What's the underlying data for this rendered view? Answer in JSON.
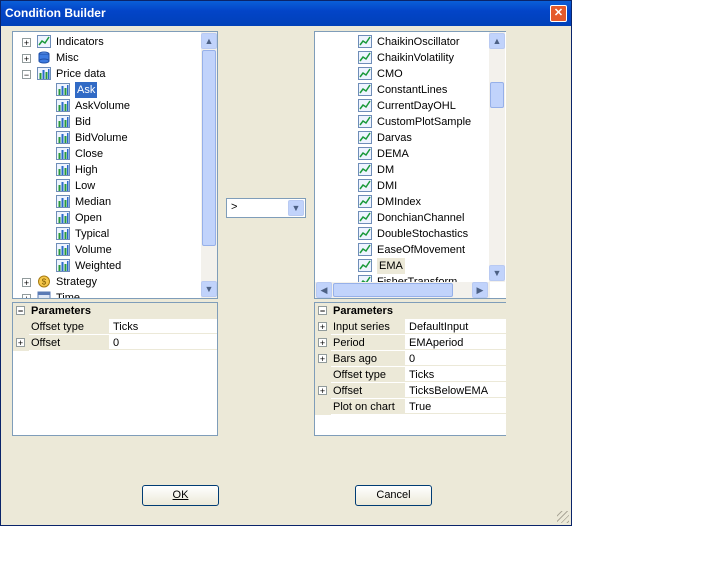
{
  "window": {
    "title": "Condition Builder",
    "close_glyph": "✕"
  },
  "left_tree": {
    "items": [
      {
        "label": "Indicators",
        "expander": "+",
        "icon": "indicator-icon"
      },
      {
        "label": "Misc",
        "expander": "+",
        "icon": "cylinder-icon"
      },
      {
        "label": "Price data",
        "expander": "−",
        "icon": "bar-chart-icon"
      },
      {
        "label": "Ask",
        "icon": "bar-chart-icon",
        "selected": true
      },
      {
        "label": "AskVolume",
        "icon": "bar-chart-icon"
      },
      {
        "label": "Bid",
        "icon": "bar-chart-icon"
      },
      {
        "label": "BidVolume",
        "icon": "bar-chart-icon"
      },
      {
        "label": "Close",
        "icon": "bar-chart-icon"
      },
      {
        "label": "High",
        "icon": "bar-chart-icon"
      },
      {
        "label": "Low",
        "icon": "bar-chart-icon"
      },
      {
        "label": "Median",
        "icon": "bar-chart-icon"
      },
      {
        "label": "Open",
        "icon": "bar-chart-icon"
      },
      {
        "label": "Typical",
        "icon": "bar-chart-icon"
      },
      {
        "label": "Volume",
        "icon": "bar-chart-icon"
      },
      {
        "label": "Weighted",
        "icon": "bar-chart-icon"
      },
      {
        "label": "Strategy",
        "expander": "+",
        "icon": "coin-icon"
      },
      {
        "label": "Time",
        "expander": "+",
        "icon": "calendar-icon"
      }
    ]
  },
  "left_params": {
    "header": "Parameters",
    "rows": [
      {
        "name": "Offset type",
        "value": "Ticks",
        "expandable": false
      },
      {
        "name": "Offset",
        "value": "0",
        "expandable": true
      }
    ]
  },
  "operator": {
    "value": ">"
  },
  "right_tree": {
    "items": [
      "ChaikinOscillator",
      "ChaikinVolatility",
      "CMO",
      "ConstantLines",
      "CurrentDayOHL",
      "CustomPlotSample",
      "Darvas",
      "DEMA",
      "DM",
      "DMI",
      "DMIndex",
      "DonchianChannel",
      "DoubleStochastics",
      "EaseOfMovement",
      "EMA",
      "FisherTransform"
    ],
    "selected": "EMA"
  },
  "right_params": {
    "header": "Parameters",
    "rows": [
      {
        "name": "Input series",
        "value": "DefaultInput",
        "expandable": true
      },
      {
        "name": "Period",
        "value": "EMAperiod",
        "expandable": true
      },
      {
        "name": "Bars ago",
        "value": "0",
        "expandable": true
      },
      {
        "name": "Offset type",
        "value": "Ticks",
        "expandable": false
      },
      {
        "name": "Offset",
        "value": "TicksBelowEMA",
        "expandable": true
      },
      {
        "name": "Plot on chart",
        "value": "True",
        "expandable": false
      }
    ]
  },
  "buttons": {
    "ok": "OK",
    "cancel": "Cancel"
  },
  "colors": {
    "title_bar": "#0344c8",
    "selection": "#316ac5",
    "face": "#ece9d8"
  }
}
